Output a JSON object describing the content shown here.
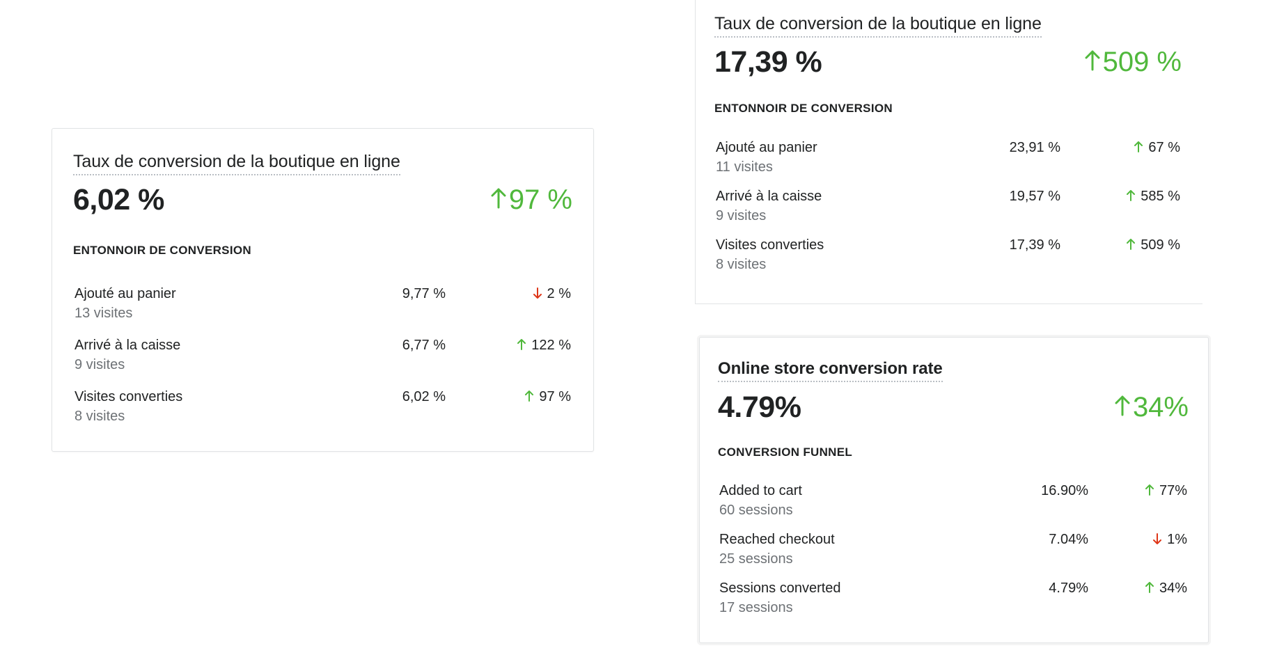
{
  "colors": {
    "positive": "#50b83c",
    "negative": "#de3618",
    "text": "#202223",
    "subdued": "#6d7175"
  },
  "cards": {
    "a": {
      "title": "Taux de conversion de la boutique en ligne",
      "value": "6,02 %",
      "change": "97 %",
      "change_direction": "up",
      "section": "ENTONNOIR DE CONVERSION",
      "rows": [
        {
          "label": "Ajouté au panier",
          "sub": "13 visites",
          "value": "9,77 %",
          "change": "2 %",
          "direction": "down",
          "arrow_icon": "arrow-down-icon"
        },
        {
          "label": "Arrivé à la caisse",
          "sub": "9 visites",
          "value": "6,77 %",
          "change": "122 %",
          "direction": "up",
          "arrow_icon": "arrow-up-icon"
        },
        {
          "label": "Visites converties",
          "sub": "8 visites",
          "value": "6,02 %",
          "change": "97 %",
          "direction": "up",
          "arrow_icon": "arrow-up-icon"
        }
      ]
    },
    "b": {
      "title": "Taux de conversion de la boutique en ligne",
      "value": "17,39 %",
      "change": "509 %",
      "change_direction": "up",
      "section": "ENTONNOIR DE CONVERSION",
      "rows": [
        {
          "label": "Ajouté au panier",
          "sub": "11 visites",
          "value": "23,91 %",
          "change": "67 %",
          "direction": "up",
          "arrow_icon": "arrow-up-icon"
        },
        {
          "label": "Arrivé à la caisse",
          "sub": "9 visites",
          "value": "19,57 %",
          "change": "585 %",
          "direction": "up",
          "arrow_icon": "arrow-up-icon"
        },
        {
          "label": "Visites converties",
          "sub": "8 visites",
          "value": "17,39 %",
          "change": "509 %",
          "direction": "up",
          "arrow_icon": "arrow-up-icon"
        }
      ]
    },
    "c": {
      "title": "Online store conversion rate",
      "value": "4.79%",
      "change": "34%",
      "change_direction": "up",
      "section": "CONVERSION FUNNEL",
      "rows": [
        {
          "label": "Added to cart",
          "sub": "60 sessions",
          "value": "16.90%",
          "change": "77%",
          "direction": "up",
          "arrow_icon": "arrow-up-icon"
        },
        {
          "label": "Reached checkout",
          "sub": "25 sessions",
          "value": "7.04%",
          "change": "1%",
          "direction": "down",
          "arrow_icon": "arrow-down-icon"
        },
        {
          "label": "Sessions converted",
          "sub": "17 sessions",
          "value": "4.79%",
          "change": "34%",
          "direction": "up",
          "arrow_icon": "arrow-up-icon"
        }
      ]
    }
  }
}
